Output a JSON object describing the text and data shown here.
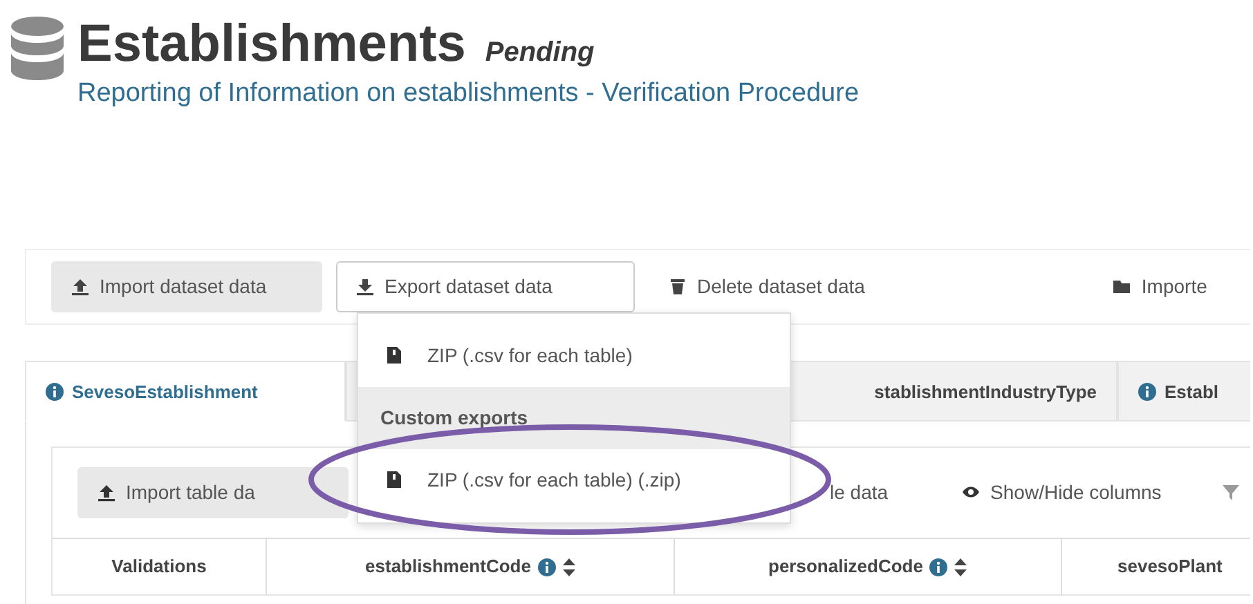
{
  "header": {
    "title": "Establishments",
    "status": "Pending",
    "subtitle": "Reporting of Information on establishments - Verification Procedure"
  },
  "dataset_toolbar": [
    {
      "label": "Import dataset data",
      "hovered": true,
      "expanded": false
    },
    {
      "label": "Export dataset data",
      "hovered": false,
      "expanded": true
    },
    {
      "label": "Delete dataset data",
      "hovered": false,
      "expanded": false
    },
    {
      "label": "Importe",
      "hovered": false,
      "expanded": false
    }
  ],
  "export_menu": [
    {
      "kind": "item",
      "label": "ZIP (.csv for each table)",
      "circled": false
    },
    {
      "kind": "header",
      "label": "Custom exports",
      "circled": false
    },
    {
      "kind": "item",
      "label": "ZIP (.csv for each table) (.zip)",
      "circled": true
    }
  ],
  "tabs": [
    {
      "label": "SevesoEstablishment",
      "selected": true,
      "info": true
    },
    {
      "label": "stablishmentIndustryType",
      "selected": false,
      "info": false
    },
    {
      "label": "Establ",
      "selected": false,
      "info": true
    }
  ],
  "table_toolbar": [
    {
      "label": "Import table da",
      "hovered": true
    },
    {
      "label": "le data",
      "hovered": false
    },
    {
      "label": "Show/Hide columns",
      "hovered": false
    }
  ],
  "columns": [
    {
      "label": "Validations",
      "info": false,
      "sortable": false
    },
    {
      "label": "establishmentCode",
      "info": true,
      "sortable": true
    },
    {
      "label": "personalizedCode",
      "info": true,
      "sortable": true
    },
    {
      "label": "sevesoPlant",
      "info": false,
      "sortable": false
    }
  ]
}
